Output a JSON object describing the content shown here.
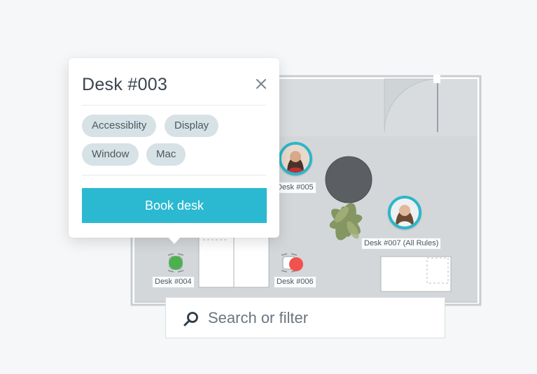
{
  "popup": {
    "title": "Desk #003",
    "close_icon": "close-icon",
    "tags": [
      "Accessiblity",
      "Display",
      "Window",
      "Mac"
    ],
    "book_label": "Book desk",
    "accent_color": "#2bb9d1"
  },
  "floorplan": {
    "desks": [
      {
        "label": "Desk #004",
        "status": "available",
        "status_color": "#4caf50"
      },
      {
        "label": "Desk #005",
        "status": "occupied"
      },
      {
        "label": "Desk #006",
        "status": "unavailable",
        "status_color": "#f0524f"
      },
      {
        "label": "Desk #007 (All Rules)",
        "status": "occupied"
      }
    ],
    "avatar_ring_color": "#2ab7c9"
  },
  "search": {
    "placeholder": "Search or filter",
    "value": "",
    "icon": "search-icon"
  }
}
